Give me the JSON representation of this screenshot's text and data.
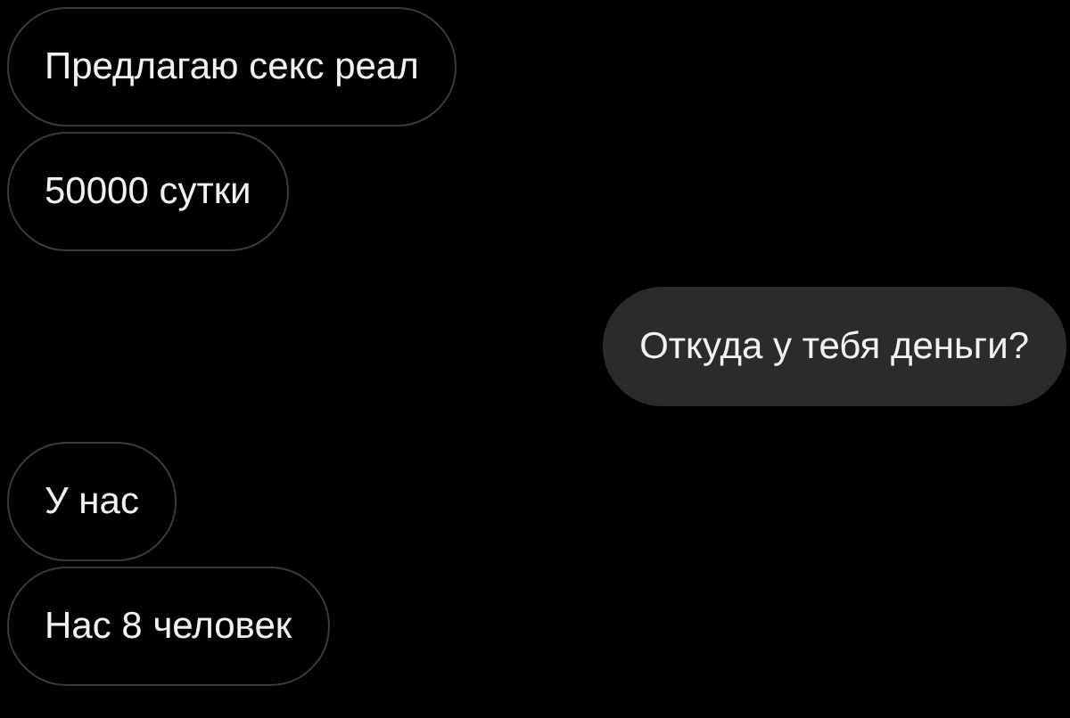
{
  "messages": [
    {
      "kind": "incoming",
      "text": "Предлагаю секс реал"
    },
    {
      "kind": "incoming",
      "text": "50000 сутки"
    },
    {
      "kind": "outgoing",
      "text": "Откуда у тебя деньги?"
    },
    {
      "kind": "incoming",
      "text": "У нас"
    },
    {
      "kind": "incoming",
      "text": "Нас 8 человек"
    }
  ]
}
